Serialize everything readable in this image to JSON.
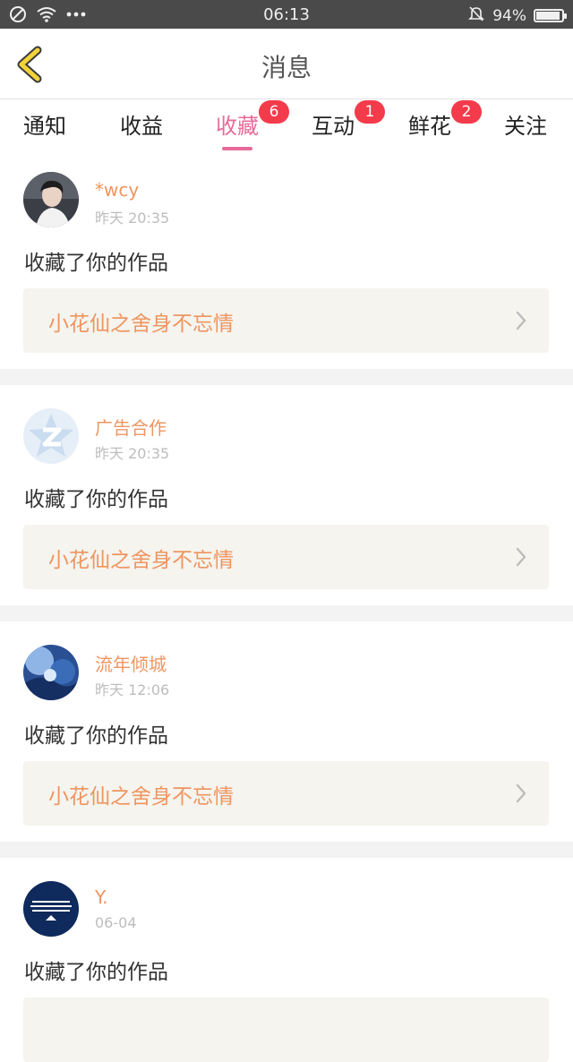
{
  "status_bar": {
    "time": "06:13",
    "battery": "94%",
    "battery_level": 0.94,
    "icons": [
      "no-sim-icon",
      "wifi-icon",
      "more-dots-icon",
      "silent-bell-icon",
      "battery-icon"
    ]
  },
  "header": {
    "title": "消息",
    "back_icon": "back-chevron-icon",
    "accent_color": "#f2d23a"
  },
  "tabs": [
    {
      "label": "通知",
      "badge": ""
    },
    {
      "label": "收益",
      "badge": ""
    },
    {
      "label": "收藏",
      "badge": "6",
      "active": true
    },
    {
      "label": "互动",
      "badge": "1"
    },
    {
      "label": "鲜花",
      "badge": "2"
    },
    {
      "label": "关注",
      "badge": ""
    }
  ],
  "colors": {
    "active_tab": "#e96a9a",
    "badge": "#f33b4b",
    "username": "#ef9560",
    "link_bg": "#f5f4ee"
  },
  "items": [
    {
      "user": "*wcy",
      "time": "昨天 20:35",
      "action": "收藏了你的作品",
      "work": "小花仙之舍身不忘情"
    },
    {
      "user": "广告合作",
      "time": "昨天 20:35",
      "action": "收藏了你的作品",
      "work": "小花仙之舍身不忘情"
    },
    {
      "user": "流年倾城",
      "time": "昨天 12:06",
      "action": "收藏了你的作品",
      "work": "小花仙之舍身不忘情"
    },
    {
      "user": "Y.",
      "time": "06-04",
      "action": "收藏了你的作品",
      "work": ""
    }
  ]
}
